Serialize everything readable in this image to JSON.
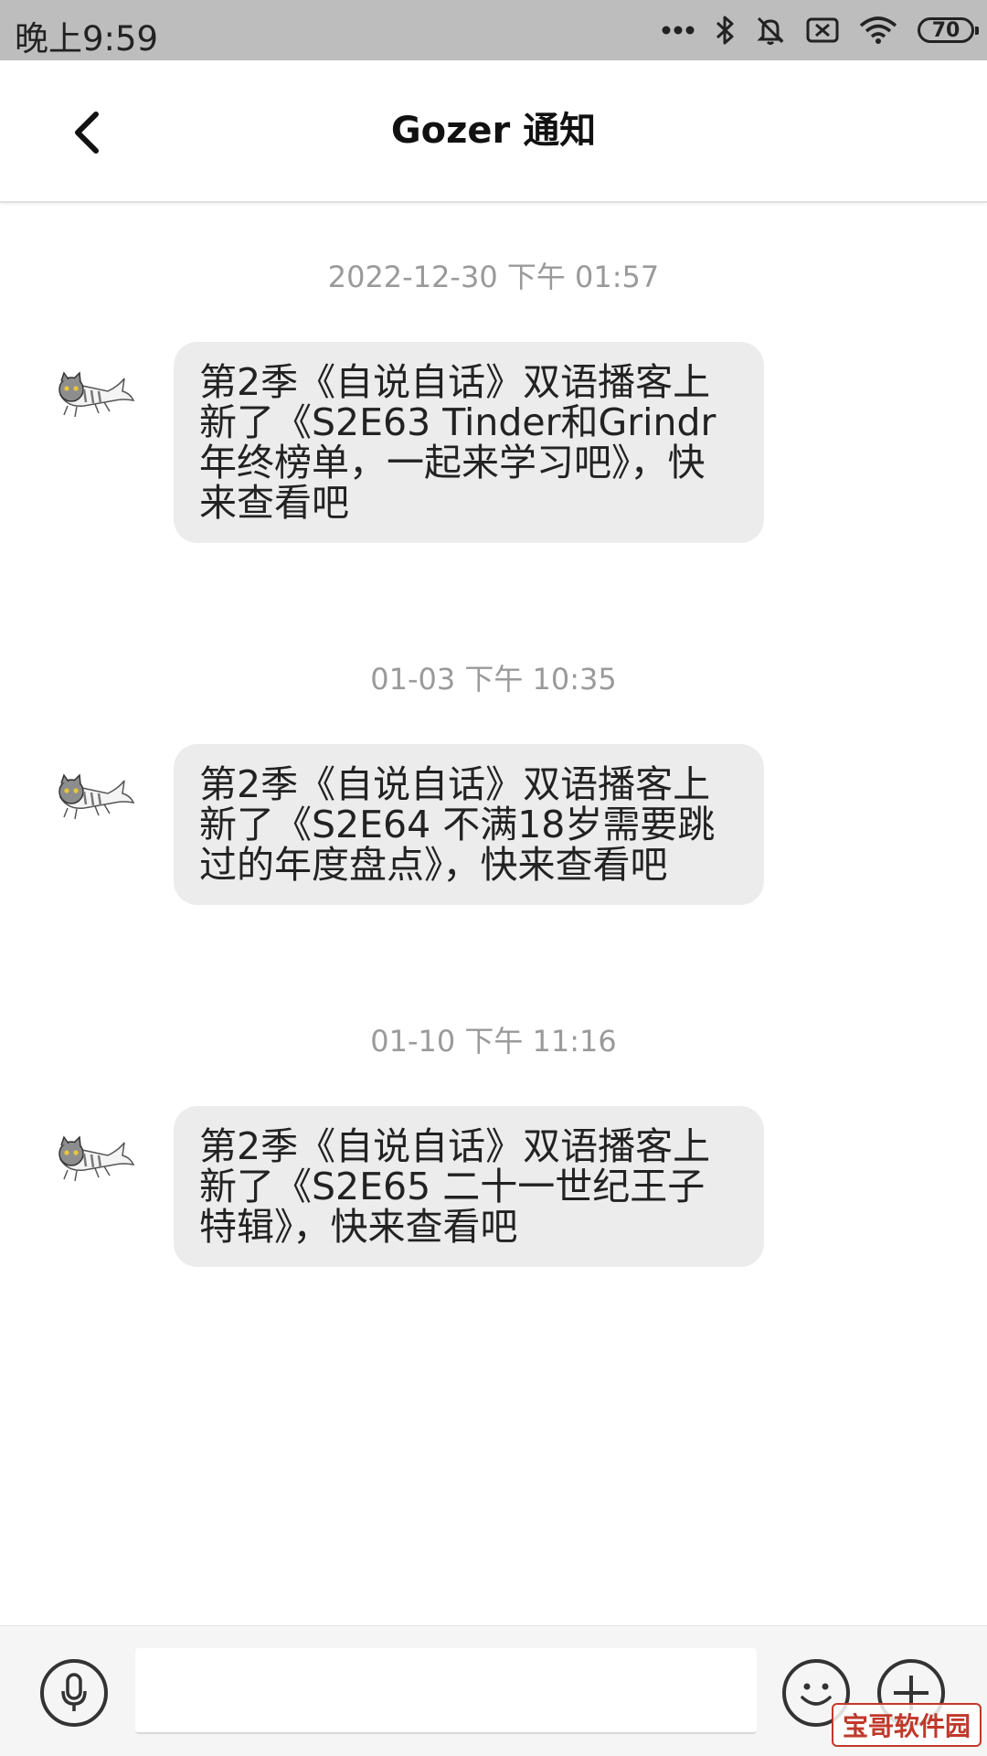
{
  "status_bar": {
    "time": "晚上9:59",
    "battery": "70",
    "icons": [
      "more-dots-icon",
      "bluetooth-icon",
      "mute-icon",
      "sim-off-icon",
      "wifi-icon",
      "battery-icon"
    ]
  },
  "header": {
    "title": "Gozer 通知",
    "back_icon": "chevron-left-icon"
  },
  "messages": [
    {
      "timestamp": "2022-12-30 下午 01:57",
      "avatar": "cat-fish-avatar",
      "text": "第2季《自说自话》双语播客上新了《S2E63 Tinder和Grindr年终榜单，一起来学习吧》，快来查看吧"
    },
    {
      "timestamp": "01-03 下午 10:35",
      "avatar": "cat-fish-avatar",
      "text": "第2季《自说自话》双语播客上新了《S2E64 不满18岁需要跳过的年度盘点》，快来查看吧"
    },
    {
      "timestamp": "01-10 下午 11:16",
      "avatar": "cat-fish-avatar",
      "text": "第2季《自说自话》双语播客上新了《S2E65 二十一世纪王子特辑》，快来查看吧"
    }
  ],
  "input_bar": {
    "voice_icon": "microphone-icon",
    "input_value": "",
    "emoji_icon": "smiley-icon",
    "plus_icon": "plus-icon"
  },
  "watermark": "宝哥软件园",
  "colors": {
    "status_bar_bg": "#bdbdbd",
    "bubble_bg": "#ececec",
    "timestamp": "#9a9a9a",
    "bottom_bar_bg": "#f5f5f5"
  }
}
